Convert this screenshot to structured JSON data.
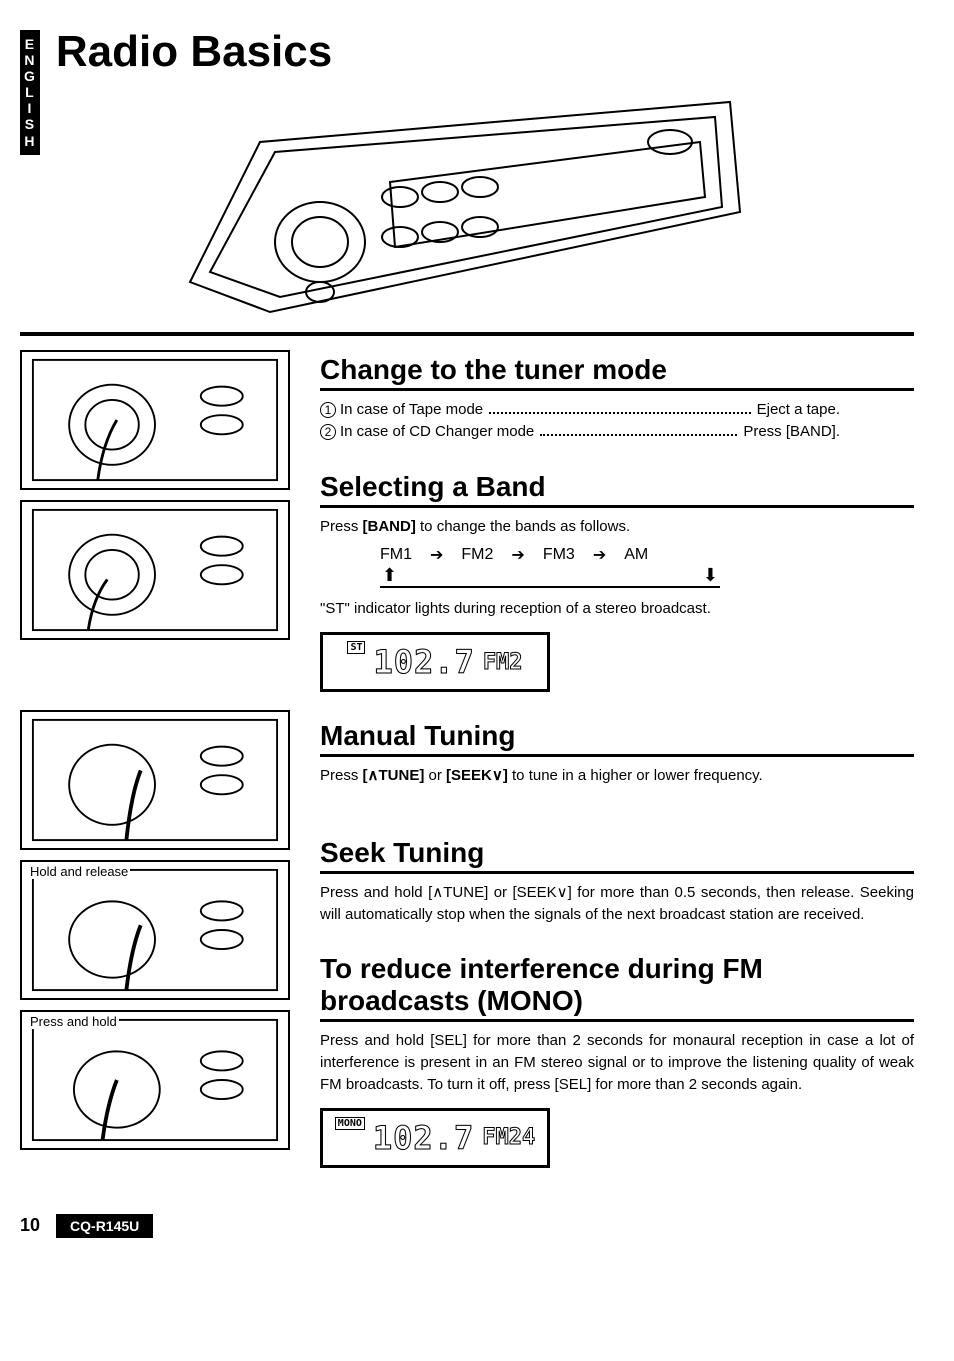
{
  "lang_tab": [
    "E",
    "N",
    "G",
    "L",
    "I",
    "S",
    "H"
  ],
  "page_title": "Radio Basics",
  "sections": {
    "change_tuner": {
      "title": "Change to the tuner mode",
      "item1_label": "In case of Tape mode",
      "item1_action": "Eject a tape.",
      "item2_label": "In case of CD Changer mode",
      "item2_action": "Press [BAND]."
    },
    "selecting_band": {
      "title": "Selecting a Band",
      "instruction_pre": "Press ",
      "instruction_btn": "[BAND]",
      "instruction_post": " to change the bands as follows.",
      "bands": [
        "FM1",
        "FM2",
        "FM3",
        "AM"
      ],
      "note": "\"ST\" indicator lights during reception of a stereo broadcast.",
      "display_indicator": "ST",
      "display_freq": "102.7",
      "display_band": "FM2"
    },
    "manual_tuning": {
      "title": "Manual Tuning",
      "text_pre": "Press ",
      "btn1": "[∧TUNE]",
      "or": " or ",
      "btn2": "[SEEK∨]",
      "text_post": " to tune in a higher or lower frequency."
    },
    "seek_tuning": {
      "title": "Seek Tuning",
      "text": "Press and hold [∧TUNE] or [SEEK∨] for more than 0.5 seconds, then release. Seeking will automatically stop when the signals of the next broadcast station are received."
    },
    "mono": {
      "title": "To reduce interference during FM broadcasts (MONO)",
      "text": "Press and hold [SEL] for more than 2 seconds for monaural reception in case a lot of interference is present in an FM stereo signal or to improve the listening quality of weak FM broadcasts. To turn it off, press [SEL] for more than 2 seconds again.",
      "display_indicator": "MONO",
      "display_freq": "102.7",
      "display_band": "FM24"
    }
  },
  "thumb_captions": {
    "t3_caption": "Hold and release",
    "t4_caption": "Press and hold"
  },
  "footer": {
    "page_number": "10",
    "model": "CQ-R145U"
  }
}
